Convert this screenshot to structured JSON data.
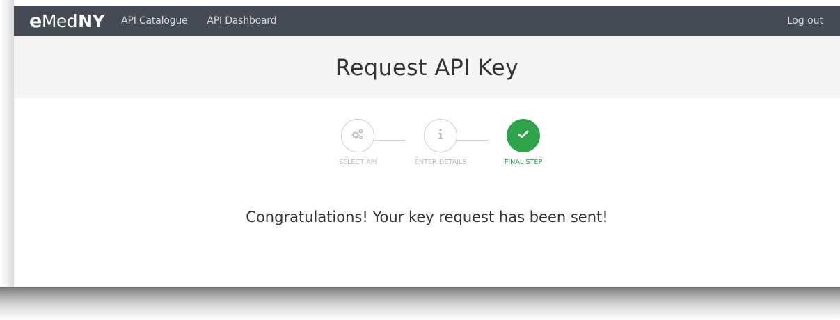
{
  "navbar": {
    "logo": {
      "e": "e",
      "med": "Med",
      "ny": "NY"
    },
    "links": [
      "API Catalogue",
      "API Dashboard"
    ],
    "logout": "Log out"
  },
  "header": {
    "title": "Request API Key"
  },
  "stepper": {
    "steps": [
      {
        "label": "SELECT API",
        "icon": "gears-icon",
        "state": "done"
      },
      {
        "label": "ENTER DETAILS",
        "icon": "info-icon",
        "state": "done"
      },
      {
        "label": "FINAL STEP",
        "icon": "check-icon",
        "state": "active"
      }
    ],
    "active_color": "#2ea34a",
    "inactive_color": "#bdbdbd"
  },
  "main": {
    "message": "Congratulations! Your key request has been sent!"
  },
  "colors": {
    "navbar": "#464a52",
    "title_band": "#f5f5f5"
  }
}
